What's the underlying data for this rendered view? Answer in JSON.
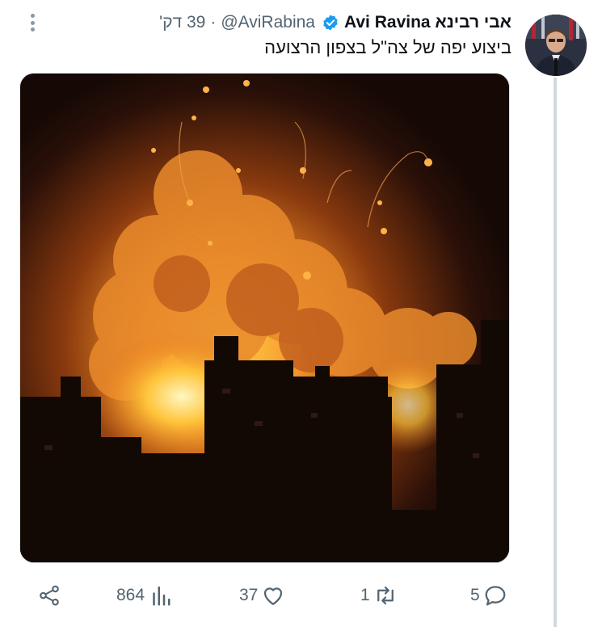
{
  "tweet": {
    "author_name": "Avi Ravina אבי רבינא",
    "handle": "@AviRabina",
    "separator": "·",
    "time_ago": "39 דק'",
    "text": "ביצוע יפה של צה\"ל בצפון הרצועה",
    "verified": true
  },
  "actions": {
    "replies": "5",
    "retweets": "1",
    "likes": "37",
    "views": "864"
  },
  "icons": {
    "more": "more-vertical-icon",
    "verified": "verified-badge-icon",
    "reply": "reply-icon",
    "retweet": "retweet-icon",
    "like": "heart-icon",
    "views": "views-bar-chart-icon",
    "share": "share-icon"
  },
  "colors": {
    "accent": "#1d9bf0",
    "muted_text": "#536471",
    "thread_line": "#cfd9de"
  }
}
